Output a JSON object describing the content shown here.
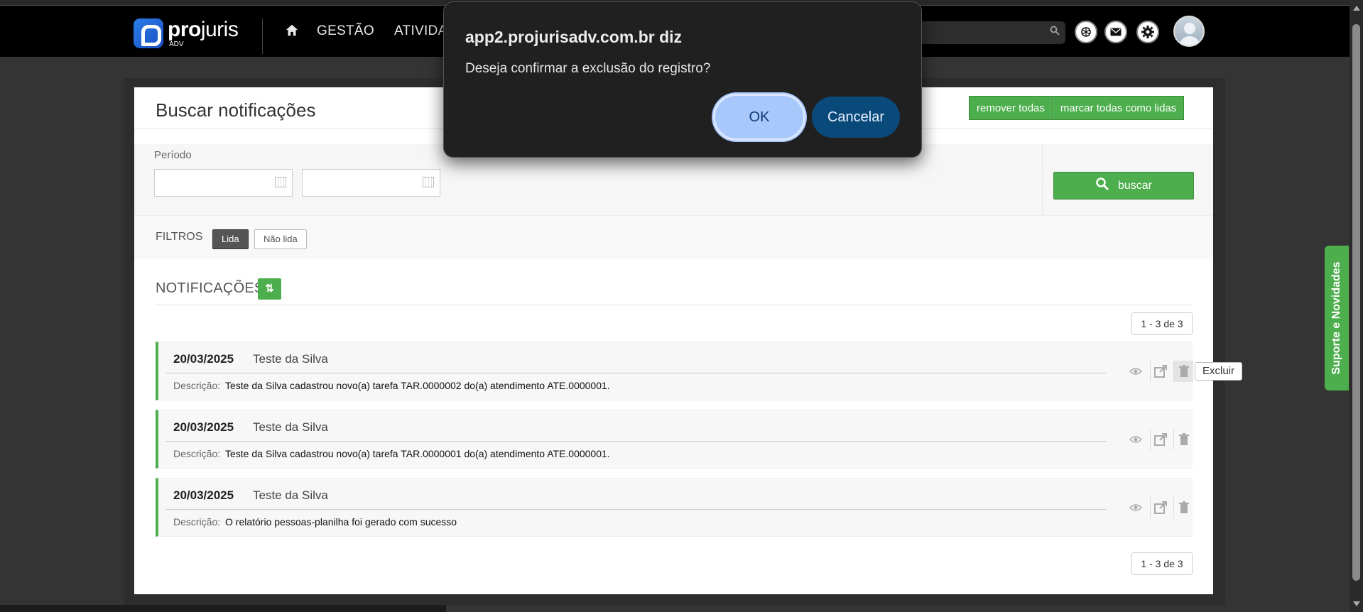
{
  "header": {
    "logo_name": "projuris",
    "logo_name_bold": "pro",
    "logo_name_rest": "juris",
    "logo_sub": "ADV",
    "nav": [
      "GESTÃO",
      "ATIVIDAD"
    ],
    "icons": [
      "home-icon",
      "openai-icon",
      "mail-icon",
      "gear-icon",
      "search-icon"
    ]
  },
  "page": {
    "title": "Buscar notificações",
    "remove_all": "remover todas",
    "mark_all_read": "marcar todas como lidas",
    "period_label": "Período",
    "date_from": "",
    "date_to": "",
    "search_button": "buscar",
    "filters_label": "FILTROS",
    "filter_read": "Lida",
    "filter_unread": "Não lida",
    "notifications_title": "NOTIFICAÇÕES",
    "pager_top": "1 - 3 de 3",
    "pager_bottom": "1 - 3 de 3"
  },
  "notifications": [
    {
      "date": "20/03/2025",
      "author": "Teste da Silva",
      "desc_label": "Descrição:",
      "desc": "Teste da Silva cadastrou novo(a) tarefa TAR.0000002 do(a) atendimento ATE.0000001."
    },
    {
      "date": "20/03/2025",
      "author": "Teste da Silva",
      "desc_label": "Descrição:",
      "desc": "Teste da Silva cadastrou novo(a) tarefa TAR.0000001 do(a) atendimento ATE.0000001."
    },
    {
      "date": "20/03/2025",
      "author": "Teste da Silva",
      "desc_label": "Descrição:",
      "desc": "O relatório pessoas-planilha foi gerado com sucesso"
    }
  ],
  "tooltip": "Excluir",
  "side_tab": "Suporte e Novidades",
  "dialog": {
    "title": "app2.projurisadv.com.br diz",
    "message": "Deseja confirmar a exclusão do registro?",
    "ok": "OK",
    "cancel": "Cancelar"
  },
  "colors": {
    "accent_green": "#4cae4c",
    "dialog_ok": "#a8c7fa",
    "dialog_cancel": "#0a4a7a"
  }
}
